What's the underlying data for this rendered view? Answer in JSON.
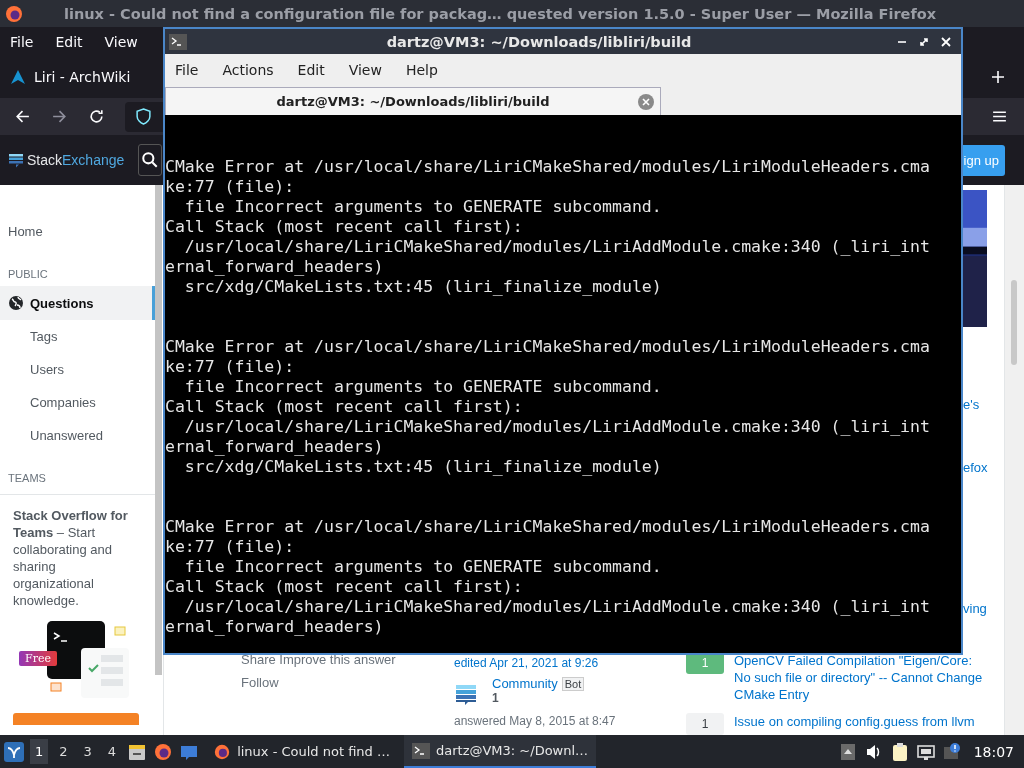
{
  "firefox": {
    "title": "linux - Could not find a configuration file for packag… quested version 1.5.0 - Super User — Mozilla Firefox",
    "menu": [
      "File",
      "Edit",
      "View"
    ],
    "tab": {
      "title": "Liri - ArchWiki"
    }
  },
  "site": {
    "logo": [
      "Stack",
      "Exchange"
    ],
    "signup": "ign up",
    "sidebar": [
      {
        "kind": "link",
        "label": "Home",
        "selected": false
      },
      {
        "kind": "heading",
        "label": "PUBLIC"
      },
      {
        "kind": "main",
        "label": "Questions",
        "selected": true
      },
      {
        "kind": "sub",
        "label": "Tags",
        "selected": false
      },
      {
        "kind": "sub",
        "label": "Users",
        "selected": false
      },
      {
        "kind": "sub",
        "label": "Companies",
        "selected": false
      },
      {
        "kind": "sub",
        "label": "Unanswered",
        "selected": false
      },
      {
        "kind": "heading",
        "label": "TEAMS"
      }
    ],
    "teams": {
      "text": "**Stack Overflow for Teams** – Start collaborating and sharing organizational knowledge.",
      "badge": "Free"
    },
    "fragments": [
      "e's",
      "efox",
      "ving"
    ],
    "answer": {
      "share": "Share  Improve this answer",
      "follow": "Follow",
      "edited": "edited Apr 21, 2021 at 9:26",
      "user": "Community",
      "user_badge": "Bot",
      "reputation": "1",
      "answered": "answered May 8, 2015 at 8:47"
    },
    "related": [
      {
        "score": "1",
        "accepted": true,
        "title": "OpenCV Failed Compilation \"Eigen/Core: No such file or directory\" -- Cannot Change CMake Entry"
      },
      {
        "score": "1",
        "accepted": false,
        "title": "Issue on compiling config.guess from llvm"
      }
    ]
  },
  "terminal": {
    "title": "dartz@VM3: ~/Downloads/libliri/build",
    "menu": [
      "File",
      "Actions",
      "Edit",
      "View",
      "Help"
    ],
    "tab": {
      "title": "dartz@VM3: ~/Downloads/libliri/build"
    },
    "output": [
      {
        "lines": [
          "CMake Error at /usr/local/share/LiriCMakeShared/modules/LiriModuleHeaders.cma",
          "ke:77 (file):",
          "  file Incorrect arguments to GENERATE subcommand.",
          "Call Stack (most recent call first):",
          "  /usr/local/share/LiriCMakeShared/modules/LiriAddModule.cmake:340 (_liri_int",
          "ernal_forward_headers)",
          "  src/xdg/CMakeLists.txt:45 (liri_finalize_module)"
        ]
      },
      {
        "lines": [
          "CMake Error at /usr/local/share/LiriCMakeShared/modules/LiriModuleHeaders.cma",
          "ke:77 (file):",
          "  file Incorrect arguments to GENERATE subcommand.",
          "Call Stack (most recent call first):",
          "  /usr/local/share/LiriCMakeShared/modules/LiriAddModule.cmake:340 (_liri_int",
          "ernal_forward_headers)",
          "  src/xdg/CMakeLists.txt:45 (liri_finalize_module)"
        ]
      },
      {
        "lines": [
          "CMake Error at /usr/local/share/LiriCMakeShared/modules/LiriModuleHeaders.cma",
          "ke:77 (file):",
          "  file Incorrect arguments to GENERATE subcommand.",
          "Call Stack (most recent call first):",
          "  /usr/local/share/LiriCMakeShared/modules/LiriAddModule.cmake:340 (_liri_int",
          "ernal_forward_headers)"
        ]
      }
    ]
  },
  "taskbar": {
    "workspaces": [
      {
        "label": "1",
        "selected": true
      },
      {
        "label": "2",
        "selected": false
      },
      {
        "label": "3",
        "selected": false
      },
      {
        "label": "4",
        "selected": false
      }
    ],
    "tasks": [
      {
        "kind": "browser",
        "title": "linux - Could not find …",
        "selected": false
      },
      {
        "kind": "terminal",
        "title": "dartz@VM3: ~/Downl…",
        "selected": true
      }
    ],
    "clock": "18:07"
  }
}
